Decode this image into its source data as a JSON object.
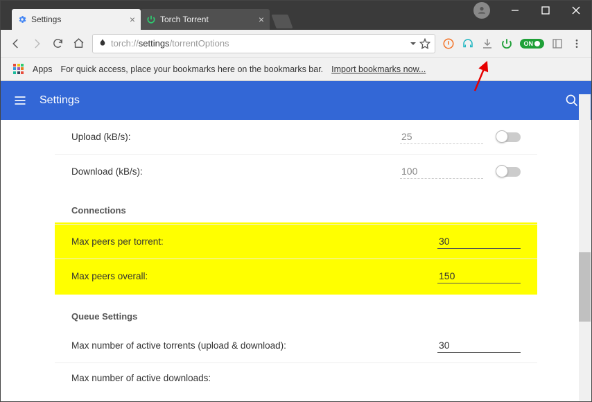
{
  "tabs": {
    "active": {
      "title": "Settings"
    },
    "inactive": {
      "title": "Torch Torrent"
    }
  },
  "address": {
    "scheme": "torch://",
    "host": "settings",
    "path": "/torrentOptions"
  },
  "bookmarks": {
    "apps_label": "Apps",
    "hint": "For quick access, place your bookmarks here on the bookmarks bar.",
    "import_label": "Import bookmarks now..."
  },
  "toolbar_badge": "ON",
  "settings": {
    "title": "Settings",
    "speed": {
      "upload_label": "Upload (kB/s):",
      "upload_value": "25",
      "download_label": "Download (kB/s):",
      "download_value": "100"
    },
    "connections": {
      "header": "Connections",
      "max_peers_torrent_label": "Max peers per torrent:",
      "max_peers_torrent_value": "30",
      "max_peers_overall_label": "Max peers overall:",
      "max_peers_overall_value": "150"
    },
    "queue": {
      "header": "Queue Settings",
      "active_torrents_label": "Max number of active torrents (upload & download):",
      "active_torrents_value": "30",
      "active_downloads_label": "Max number of active downloads:"
    }
  }
}
